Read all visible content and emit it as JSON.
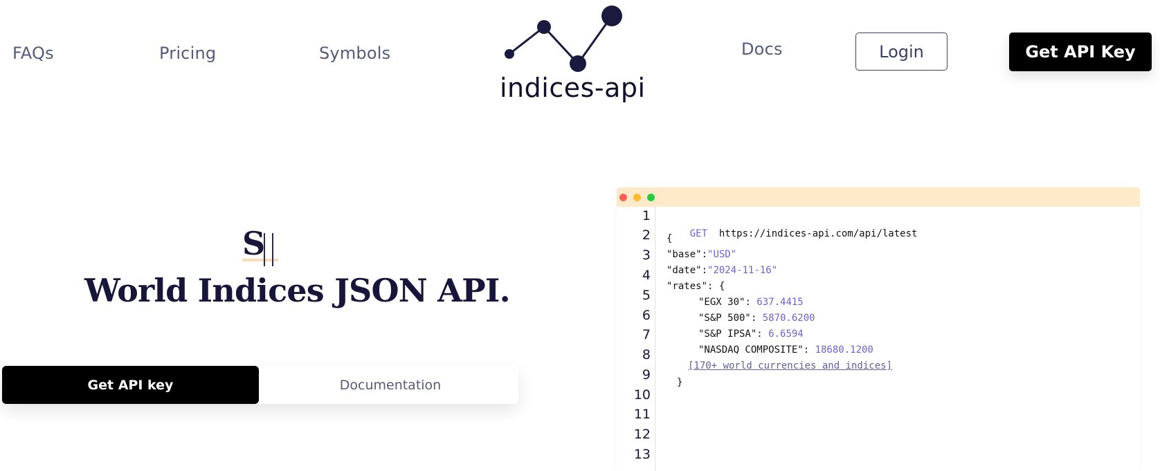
{
  "nav": {
    "faqs": "FAQs",
    "pricing": "Pricing",
    "symbols": "Symbols",
    "docs": "Docs",
    "login": "Login",
    "get_api_key": "Get API Key"
  },
  "logo": {
    "text": "indices-api",
    "icon": "line-graph-icon"
  },
  "hero": {
    "typed_text": "S",
    "headline": "World Indices JSON API.",
    "primary_cta": "Get API key",
    "secondary_cta": "Documentation"
  },
  "code": {
    "method": "GET",
    "url": "https://indices-api.com/api/latest",
    "open_brace": "{",
    "base_key": "\"base\"",
    "base_value": "\"USD\"",
    "date_key": "\"date\"",
    "date_value": "\"2024-11-16\"",
    "rates_key": "\"rates\"",
    "rates_open": ": {",
    "rates": [
      {
        "key": "\"EGX 30\"",
        "value": "637.4415"
      },
      {
        "key": "\"S&P 500\"",
        "value": "5870.6200"
      },
      {
        "key": "\"S&P IPSA\"",
        "value": "6.6594"
      },
      {
        "key": "\"NASDAQ COMPOSITE\"",
        "value": "18680.1200"
      }
    ],
    "more_link": "[170+ world currencies and indices]",
    "close_brace": "}",
    "line_numbers": [
      "1",
      "2",
      "3",
      "4",
      "5",
      "6",
      "7",
      "8",
      "9",
      "10",
      "11",
      "12",
      "13"
    ]
  },
  "colors": {
    "brand_dark": "#17163a",
    "titlebar": "#fee9c9",
    "accent_purple": "#6b60d8"
  }
}
